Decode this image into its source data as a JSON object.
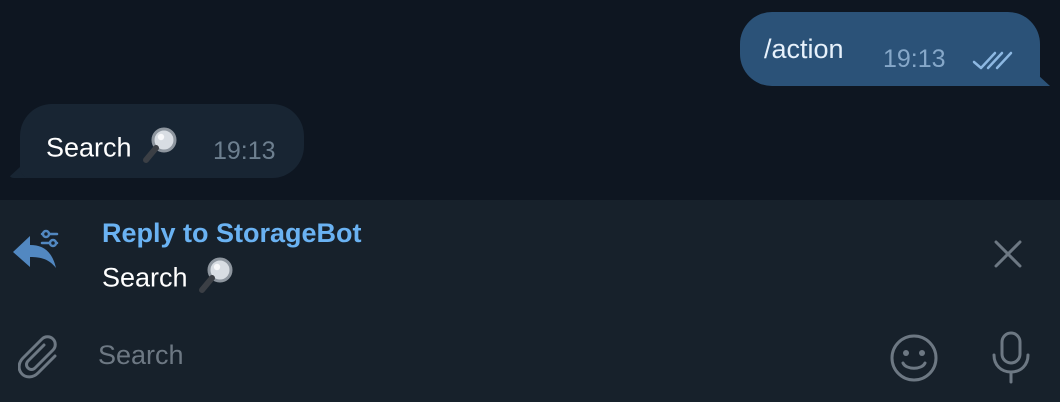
{
  "messages": [
    {
      "direction": "outgoing",
      "text": "/action",
      "time": "19:13",
      "status_icon": "double-check-icon"
    },
    {
      "direction": "incoming",
      "text": "Search",
      "emoji": "magnifying-glass-icon",
      "time": "19:13"
    }
  ],
  "reply": {
    "title": "Reply to StorageBot",
    "preview_text": "Search",
    "preview_emoji": "magnifying-glass-icon",
    "icon": "reply-arrow-icon",
    "close_icon": "close-icon"
  },
  "composer": {
    "placeholder": "Search",
    "value": "",
    "attach_icon": "paperclip-icon",
    "emoji_icon": "emoji-icon",
    "mic_icon": "microphone-icon"
  },
  "colors": {
    "chat_background": "#0e1621",
    "panel_background": "#17212b",
    "outgoing_bubble": "#2b5278",
    "incoming_bubble": "#182533",
    "accent": "#6ab2f2",
    "icon_gray": "#6d7883"
  }
}
